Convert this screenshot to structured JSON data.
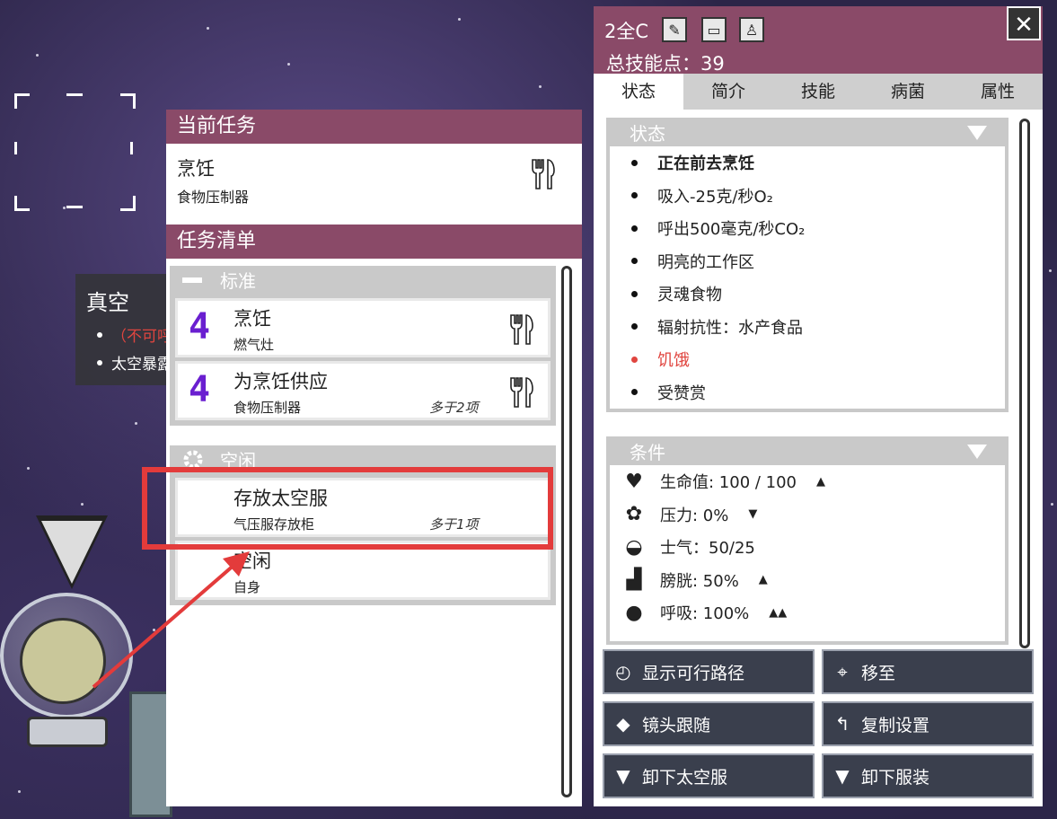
{
  "tooltip": {
    "title": "真空",
    "items": [
      "（不可呼吸）",
      "太空暴露"
    ]
  },
  "current_task": {
    "header": "当前任务",
    "name": "烹饪",
    "target": "食物压制器",
    "icon": "fork-knife-icon"
  },
  "task_list": {
    "header": "任务清单",
    "groups": [
      {
        "label": "标准",
        "icon": "minus-icon",
        "rows": [
          {
            "priority": "4",
            "name": "烹饪",
            "target": "燃气灶",
            "more": "",
            "icon": "fork-knife-icon"
          },
          {
            "priority": "4",
            "name": "为烹饪供应",
            "target": "食物压制器",
            "more": "多于2项",
            "icon": "fork-knife-icon"
          }
        ]
      },
      {
        "label": "空闲",
        "icon": "gear-icon",
        "rows": [
          {
            "priority": "",
            "name": "存放太空服",
            "target": "气压服存放柜",
            "more": "多于1项"
          },
          {
            "priority": "",
            "name": "空闲",
            "target": "自身",
            "more": ""
          }
        ]
      }
    ]
  },
  "details": {
    "name": "2全C",
    "skill_points": "总技能点：39",
    "icons": [
      "pencil-icon",
      "book-icon",
      "outfit-icon"
    ],
    "close": "✕",
    "tabs": [
      "状态",
      "简介",
      "技能",
      "病菌",
      "属性"
    ],
    "active_tab": "状态",
    "status": {
      "header": "状态",
      "items": [
        {
          "text": "正在前去烹饪",
          "style": "bold"
        },
        {
          "text": "吸入-25克/秒O₂",
          "style": "normal"
        },
        {
          "text": "呼出500毫克/秒CO₂",
          "style": "normal"
        },
        {
          "text": "明亮的工作区",
          "style": "normal"
        },
        {
          "text": "灵魂食物",
          "style": "normal"
        },
        {
          "text": "辐射抗性：水产食品",
          "style": "normal"
        },
        {
          "text": "饥饿",
          "style": "red"
        },
        {
          "text": "受赞赏",
          "style": "normal"
        }
      ]
    },
    "conditions": {
      "header": "条件",
      "items": [
        {
          "icon": "heart-icon",
          "text": "生命值: 100 / 100",
          "trend": "▲"
        },
        {
          "icon": "stress-icon",
          "text": "压力: 0%",
          "trend": "▼"
        },
        {
          "icon": "morale-icon",
          "text": "士气：50/25",
          "trend": ""
        },
        {
          "icon": "bladder-icon",
          "text": "膀胱: 50%",
          "trend": "▲"
        },
        {
          "icon": "breath-icon",
          "text": "呼吸: 100%",
          "trend": "▲▲"
        }
      ]
    },
    "buttons": [
      {
        "label": "显示可行路径",
        "icon": "navigate-icon"
      },
      {
        "label": "移至",
        "icon": "crosshair-icon"
      },
      {
        "label": "镜头跟随",
        "icon": "camera-icon"
      },
      {
        "label": "复制设置",
        "icon": "copy-icon"
      },
      {
        "label": "卸下太空服",
        "icon": "drop-icon"
      },
      {
        "label": "卸下服装",
        "icon": "drop-icon"
      }
    ]
  },
  "colors": {
    "header": "#8a4a68",
    "priority": "#6a1fd0",
    "highlight": "#e33b3b",
    "warning": "#e0453f"
  }
}
